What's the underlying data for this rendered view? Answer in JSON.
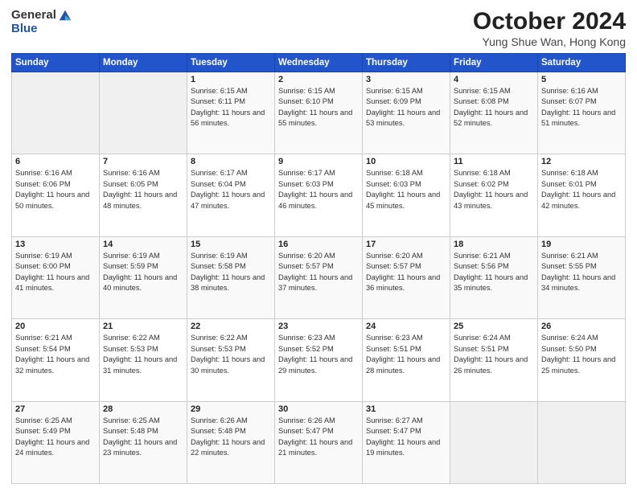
{
  "header": {
    "logo_general": "General",
    "logo_blue": "Blue",
    "title": "October 2024",
    "location": "Yung Shue Wan, Hong Kong"
  },
  "weekdays": [
    "Sunday",
    "Monday",
    "Tuesday",
    "Wednesday",
    "Thursday",
    "Friday",
    "Saturday"
  ],
  "weeks": [
    [
      {
        "day": "",
        "info": ""
      },
      {
        "day": "",
        "info": ""
      },
      {
        "day": "1",
        "sunrise": "Sunrise: 6:15 AM",
        "sunset": "Sunset: 6:11 PM",
        "daylight": "Daylight: 11 hours and 56 minutes."
      },
      {
        "day": "2",
        "sunrise": "Sunrise: 6:15 AM",
        "sunset": "Sunset: 6:10 PM",
        "daylight": "Daylight: 11 hours and 55 minutes."
      },
      {
        "day": "3",
        "sunrise": "Sunrise: 6:15 AM",
        "sunset": "Sunset: 6:09 PM",
        "daylight": "Daylight: 11 hours and 53 minutes."
      },
      {
        "day": "4",
        "sunrise": "Sunrise: 6:15 AM",
        "sunset": "Sunset: 6:08 PM",
        "daylight": "Daylight: 11 hours and 52 minutes."
      },
      {
        "day": "5",
        "sunrise": "Sunrise: 6:16 AM",
        "sunset": "Sunset: 6:07 PM",
        "daylight": "Daylight: 11 hours and 51 minutes."
      }
    ],
    [
      {
        "day": "6",
        "sunrise": "Sunrise: 6:16 AM",
        "sunset": "Sunset: 6:06 PM",
        "daylight": "Daylight: 11 hours and 50 minutes."
      },
      {
        "day": "7",
        "sunrise": "Sunrise: 6:16 AM",
        "sunset": "Sunset: 6:05 PM",
        "daylight": "Daylight: 11 hours and 48 minutes."
      },
      {
        "day": "8",
        "sunrise": "Sunrise: 6:17 AM",
        "sunset": "Sunset: 6:04 PM",
        "daylight": "Daylight: 11 hours and 47 minutes."
      },
      {
        "day": "9",
        "sunrise": "Sunrise: 6:17 AM",
        "sunset": "Sunset: 6:03 PM",
        "daylight": "Daylight: 11 hours and 46 minutes."
      },
      {
        "day": "10",
        "sunrise": "Sunrise: 6:18 AM",
        "sunset": "Sunset: 6:03 PM",
        "daylight": "Daylight: 11 hours and 45 minutes."
      },
      {
        "day": "11",
        "sunrise": "Sunrise: 6:18 AM",
        "sunset": "Sunset: 6:02 PM",
        "daylight": "Daylight: 11 hours and 43 minutes."
      },
      {
        "day": "12",
        "sunrise": "Sunrise: 6:18 AM",
        "sunset": "Sunset: 6:01 PM",
        "daylight": "Daylight: 11 hours and 42 minutes."
      }
    ],
    [
      {
        "day": "13",
        "sunrise": "Sunrise: 6:19 AM",
        "sunset": "Sunset: 6:00 PM",
        "daylight": "Daylight: 11 hours and 41 minutes."
      },
      {
        "day": "14",
        "sunrise": "Sunrise: 6:19 AM",
        "sunset": "Sunset: 5:59 PM",
        "daylight": "Daylight: 11 hours and 40 minutes."
      },
      {
        "day": "15",
        "sunrise": "Sunrise: 6:19 AM",
        "sunset": "Sunset: 5:58 PM",
        "daylight": "Daylight: 11 hours and 38 minutes."
      },
      {
        "day": "16",
        "sunrise": "Sunrise: 6:20 AM",
        "sunset": "Sunset: 5:57 PM",
        "daylight": "Daylight: 11 hours and 37 minutes."
      },
      {
        "day": "17",
        "sunrise": "Sunrise: 6:20 AM",
        "sunset": "Sunset: 5:57 PM",
        "daylight": "Daylight: 11 hours and 36 minutes."
      },
      {
        "day": "18",
        "sunrise": "Sunrise: 6:21 AM",
        "sunset": "Sunset: 5:56 PM",
        "daylight": "Daylight: 11 hours and 35 minutes."
      },
      {
        "day": "19",
        "sunrise": "Sunrise: 6:21 AM",
        "sunset": "Sunset: 5:55 PM",
        "daylight": "Daylight: 11 hours and 34 minutes."
      }
    ],
    [
      {
        "day": "20",
        "sunrise": "Sunrise: 6:21 AM",
        "sunset": "Sunset: 5:54 PM",
        "daylight": "Daylight: 11 hours and 32 minutes."
      },
      {
        "day": "21",
        "sunrise": "Sunrise: 6:22 AM",
        "sunset": "Sunset: 5:53 PM",
        "daylight": "Daylight: 11 hours and 31 minutes."
      },
      {
        "day": "22",
        "sunrise": "Sunrise: 6:22 AM",
        "sunset": "Sunset: 5:53 PM",
        "daylight": "Daylight: 11 hours and 30 minutes."
      },
      {
        "day": "23",
        "sunrise": "Sunrise: 6:23 AM",
        "sunset": "Sunset: 5:52 PM",
        "daylight": "Daylight: 11 hours and 29 minutes."
      },
      {
        "day": "24",
        "sunrise": "Sunrise: 6:23 AM",
        "sunset": "Sunset: 5:51 PM",
        "daylight": "Daylight: 11 hours and 28 minutes."
      },
      {
        "day": "25",
        "sunrise": "Sunrise: 6:24 AM",
        "sunset": "Sunset: 5:51 PM",
        "daylight": "Daylight: 11 hours and 26 minutes."
      },
      {
        "day": "26",
        "sunrise": "Sunrise: 6:24 AM",
        "sunset": "Sunset: 5:50 PM",
        "daylight": "Daylight: 11 hours and 25 minutes."
      }
    ],
    [
      {
        "day": "27",
        "sunrise": "Sunrise: 6:25 AM",
        "sunset": "Sunset: 5:49 PM",
        "daylight": "Daylight: 11 hours and 24 minutes."
      },
      {
        "day": "28",
        "sunrise": "Sunrise: 6:25 AM",
        "sunset": "Sunset: 5:48 PM",
        "daylight": "Daylight: 11 hours and 23 minutes."
      },
      {
        "day": "29",
        "sunrise": "Sunrise: 6:26 AM",
        "sunset": "Sunset: 5:48 PM",
        "daylight": "Daylight: 11 hours and 22 minutes."
      },
      {
        "day": "30",
        "sunrise": "Sunrise: 6:26 AM",
        "sunset": "Sunset: 5:47 PM",
        "daylight": "Daylight: 11 hours and 21 minutes."
      },
      {
        "day": "31",
        "sunrise": "Sunrise: 6:27 AM",
        "sunset": "Sunset: 5:47 PM",
        "daylight": "Daylight: 11 hours and 19 minutes."
      },
      {
        "day": "",
        "info": ""
      },
      {
        "day": "",
        "info": ""
      }
    ]
  ]
}
